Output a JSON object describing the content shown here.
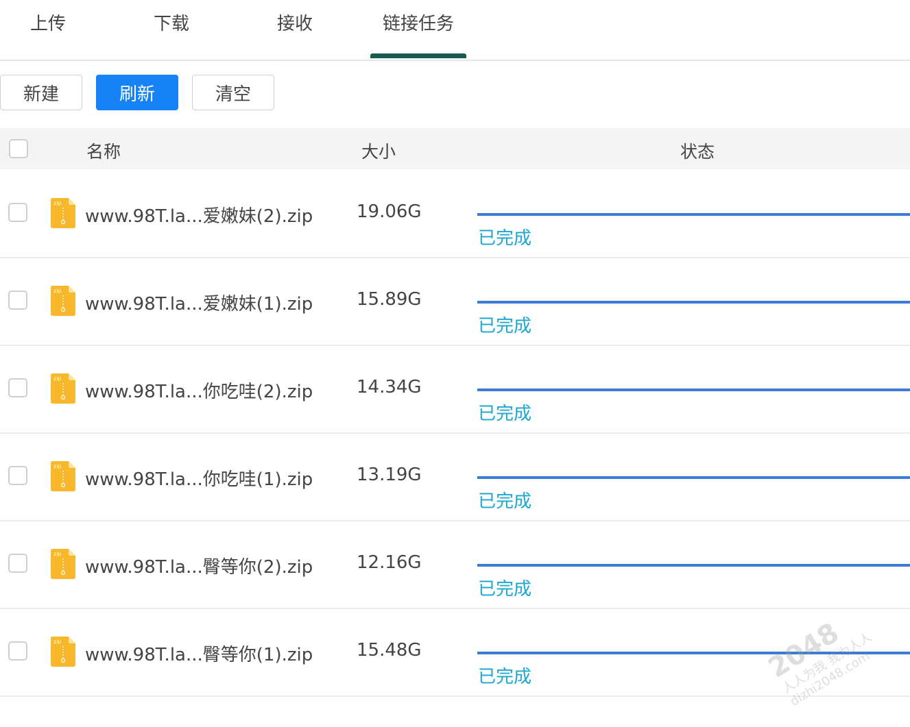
{
  "tabs": [
    {
      "label": "上传"
    },
    {
      "label": "下载"
    },
    {
      "label": "接收"
    },
    {
      "label": "链接任务",
      "active": true
    }
  ],
  "toolbar": {
    "new_label": "新建",
    "refresh_label": "刷新",
    "clear_label": "清空"
  },
  "table": {
    "headers": {
      "name": "名称",
      "size": "大小",
      "status": "状态"
    },
    "rows": [
      {
        "name": "www.98T.la...爱嫩妹(2).zip",
        "size": "19.06G",
        "status": "已完成",
        "progress": 1.0,
        "icon": "zip-file-icon"
      },
      {
        "name": "www.98T.la...爱嫩妹(1).zip",
        "size": "15.89G",
        "status": "已完成",
        "progress": 1.0,
        "icon": "zip-file-icon"
      },
      {
        "name": "www.98T.la...你吃哇(2).zip",
        "size": "14.34G",
        "status": "已完成",
        "progress": 1.0,
        "icon": "zip-file-icon"
      },
      {
        "name": "www.98T.la...你吃哇(1).zip",
        "size": "13.19G",
        "status": "已完成",
        "progress": 1.0,
        "icon": "zip-file-icon"
      },
      {
        "name": "www.98T.la...臀等你(2).zip",
        "size": "12.16G",
        "status": "已完成",
        "progress": 1.0,
        "icon": "zip-file-icon"
      },
      {
        "name": "www.98T.la...臀等你(1).zip",
        "size": "15.48G",
        "status": "已完成",
        "progress": 1.0,
        "icon": "zip-file-icon"
      }
    ]
  },
  "watermark": {
    "big": "2048",
    "line1": "人人为我 我为人人",
    "line2": "dizhi2048.com"
  },
  "colors": {
    "accent": "#1682f6",
    "tab_indicator": "#1b5a4e",
    "progress": "#3a7bd5",
    "status_done": "#1da7d0",
    "zip_icon": "#f9b82b"
  }
}
